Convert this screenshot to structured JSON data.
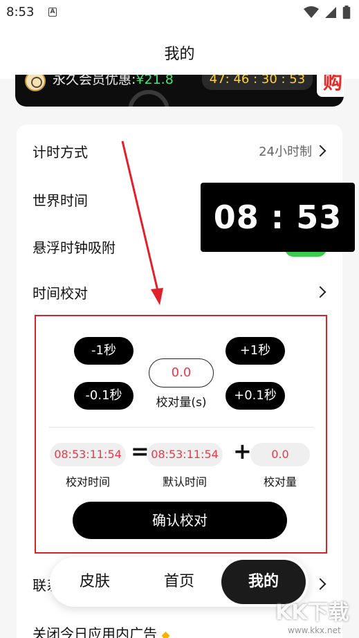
{
  "status_bar": {
    "time": "8:53",
    "a_icon": "A"
  },
  "header": {
    "title": "我的"
  },
  "banner": {
    "text": "永久会员优惠:",
    "price": "¥21.8",
    "countdown": "47: 46 : 30 : 53",
    "buy_label": "购"
  },
  "settings": {
    "time_format": {
      "label": "计时方式",
      "value": "24小时制"
    },
    "world_time": {
      "label": "世界时间"
    },
    "float_clock_snap": {
      "label": "悬浮时钟吸附"
    },
    "time_calibration": {
      "label": "时间校对"
    },
    "contact": {
      "label": "联系"
    },
    "close_ads": {
      "label": "关闭今日应用内广告"
    }
  },
  "clock_overlay": {
    "time": "08 : 53"
  },
  "calibration": {
    "minus_1": "-1秒",
    "minus_01": "-0.1秒",
    "plus_1": "+1秒",
    "plus_01": "+0.1秒",
    "amount_value": "0.0",
    "amount_label": "校对量(s)",
    "calibrated_time": "08:53:11:54",
    "calibrated_time_label": "校对时间",
    "equals": "=",
    "default_time": "08:53:11:54",
    "default_time_label": "默认时间",
    "plus": "+",
    "offset_value": "0.0",
    "offset_label": "校对量",
    "confirm_label": "确认校对"
  },
  "bottom_nav": {
    "items": [
      {
        "label": "皮肤"
      },
      {
        "label": "首页"
      },
      {
        "label": "我的"
      }
    ]
  },
  "watermark": {
    "main": "KK下载",
    "url": "www.kkx.net"
  },
  "colors": {
    "accent_red": "#e63a4b",
    "toggle_green": "#3ccb4f",
    "countdown_yellow": "#ffd23f"
  }
}
